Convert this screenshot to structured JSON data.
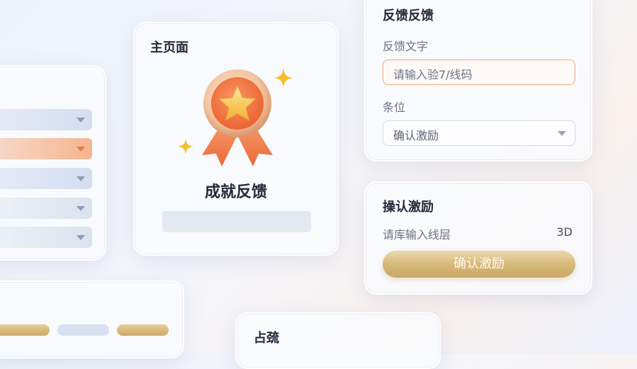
{
  "main_card": {
    "title": "主页面",
    "achievement_title": "成就反馈"
  },
  "feedback_card": {
    "title": "反馈反馈",
    "text_label": "反馈文字",
    "input_placeholder": "请输入验7/线码",
    "position_label": "条位",
    "position_selected": "确认激励"
  },
  "reward_card": {
    "title": "操认激励",
    "input_label": "请库输入线层",
    "value": "3D",
    "confirm_label": "确认激励"
  },
  "bottom_card": {
    "title": "占巯"
  },
  "colors": {
    "accent_orange": "#f07a3e",
    "gold": "#d5b777",
    "star": "#f5b92e"
  },
  "icons": {
    "badge": "medal-star-icon",
    "sparkle": "sparkle-icon",
    "dropdown": "chevron-down-icon"
  }
}
